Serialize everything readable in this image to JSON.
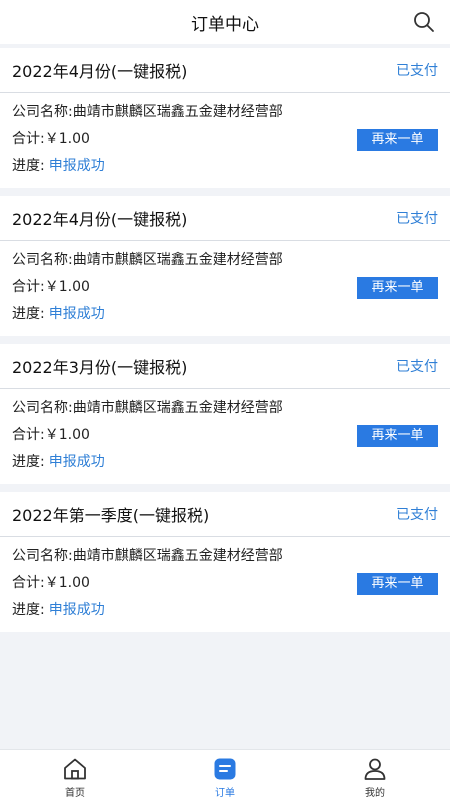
{
  "header": {
    "title": "订单中心"
  },
  "orders": [
    {
      "period": "2022年4月份(一键报税)",
      "status": "已支付",
      "company": "公司名称:曲靖市麒麟区瑞鑫五金建材经营部",
      "total": "合计:￥1.00",
      "progress_label": "进度:",
      "progress_value": "申报成功",
      "action": "再来一单"
    },
    {
      "period": "2022年4月份(一键报税)",
      "status": "已支付",
      "company": "公司名称:曲靖市麒麟区瑞鑫五金建材经营部",
      "total": "合计:￥1.00",
      "progress_label": "进度:",
      "progress_value": "申报成功",
      "action": "再来一单"
    },
    {
      "period": "2022年3月份(一键报税)",
      "status": "已支付",
      "company": "公司名称:曲靖市麒麟区瑞鑫五金建材经营部",
      "total": "合计:￥1.00",
      "progress_label": "进度:",
      "progress_value": "申报成功",
      "action": "再来一单"
    },
    {
      "period": "2022年第一季度(一键报税)",
      "status": "已支付",
      "company": "公司名称:曲靖市麒麟区瑞鑫五金建材经营部",
      "total": "合计:￥1.00",
      "progress_label": "进度:",
      "progress_value": "申报成功",
      "action": "再来一单"
    }
  ],
  "tabbar": {
    "items": [
      {
        "label": "首页",
        "icon": "home-icon",
        "active": false
      },
      {
        "label": "订单",
        "icon": "order-icon",
        "active": true
      },
      {
        "label": "我的",
        "icon": "profile-icon",
        "active": false
      }
    ]
  },
  "colors": {
    "accent": "#2a7ae2",
    "link": "#2f7fd6",
    "background": "#f1f3f7"
  }
}
